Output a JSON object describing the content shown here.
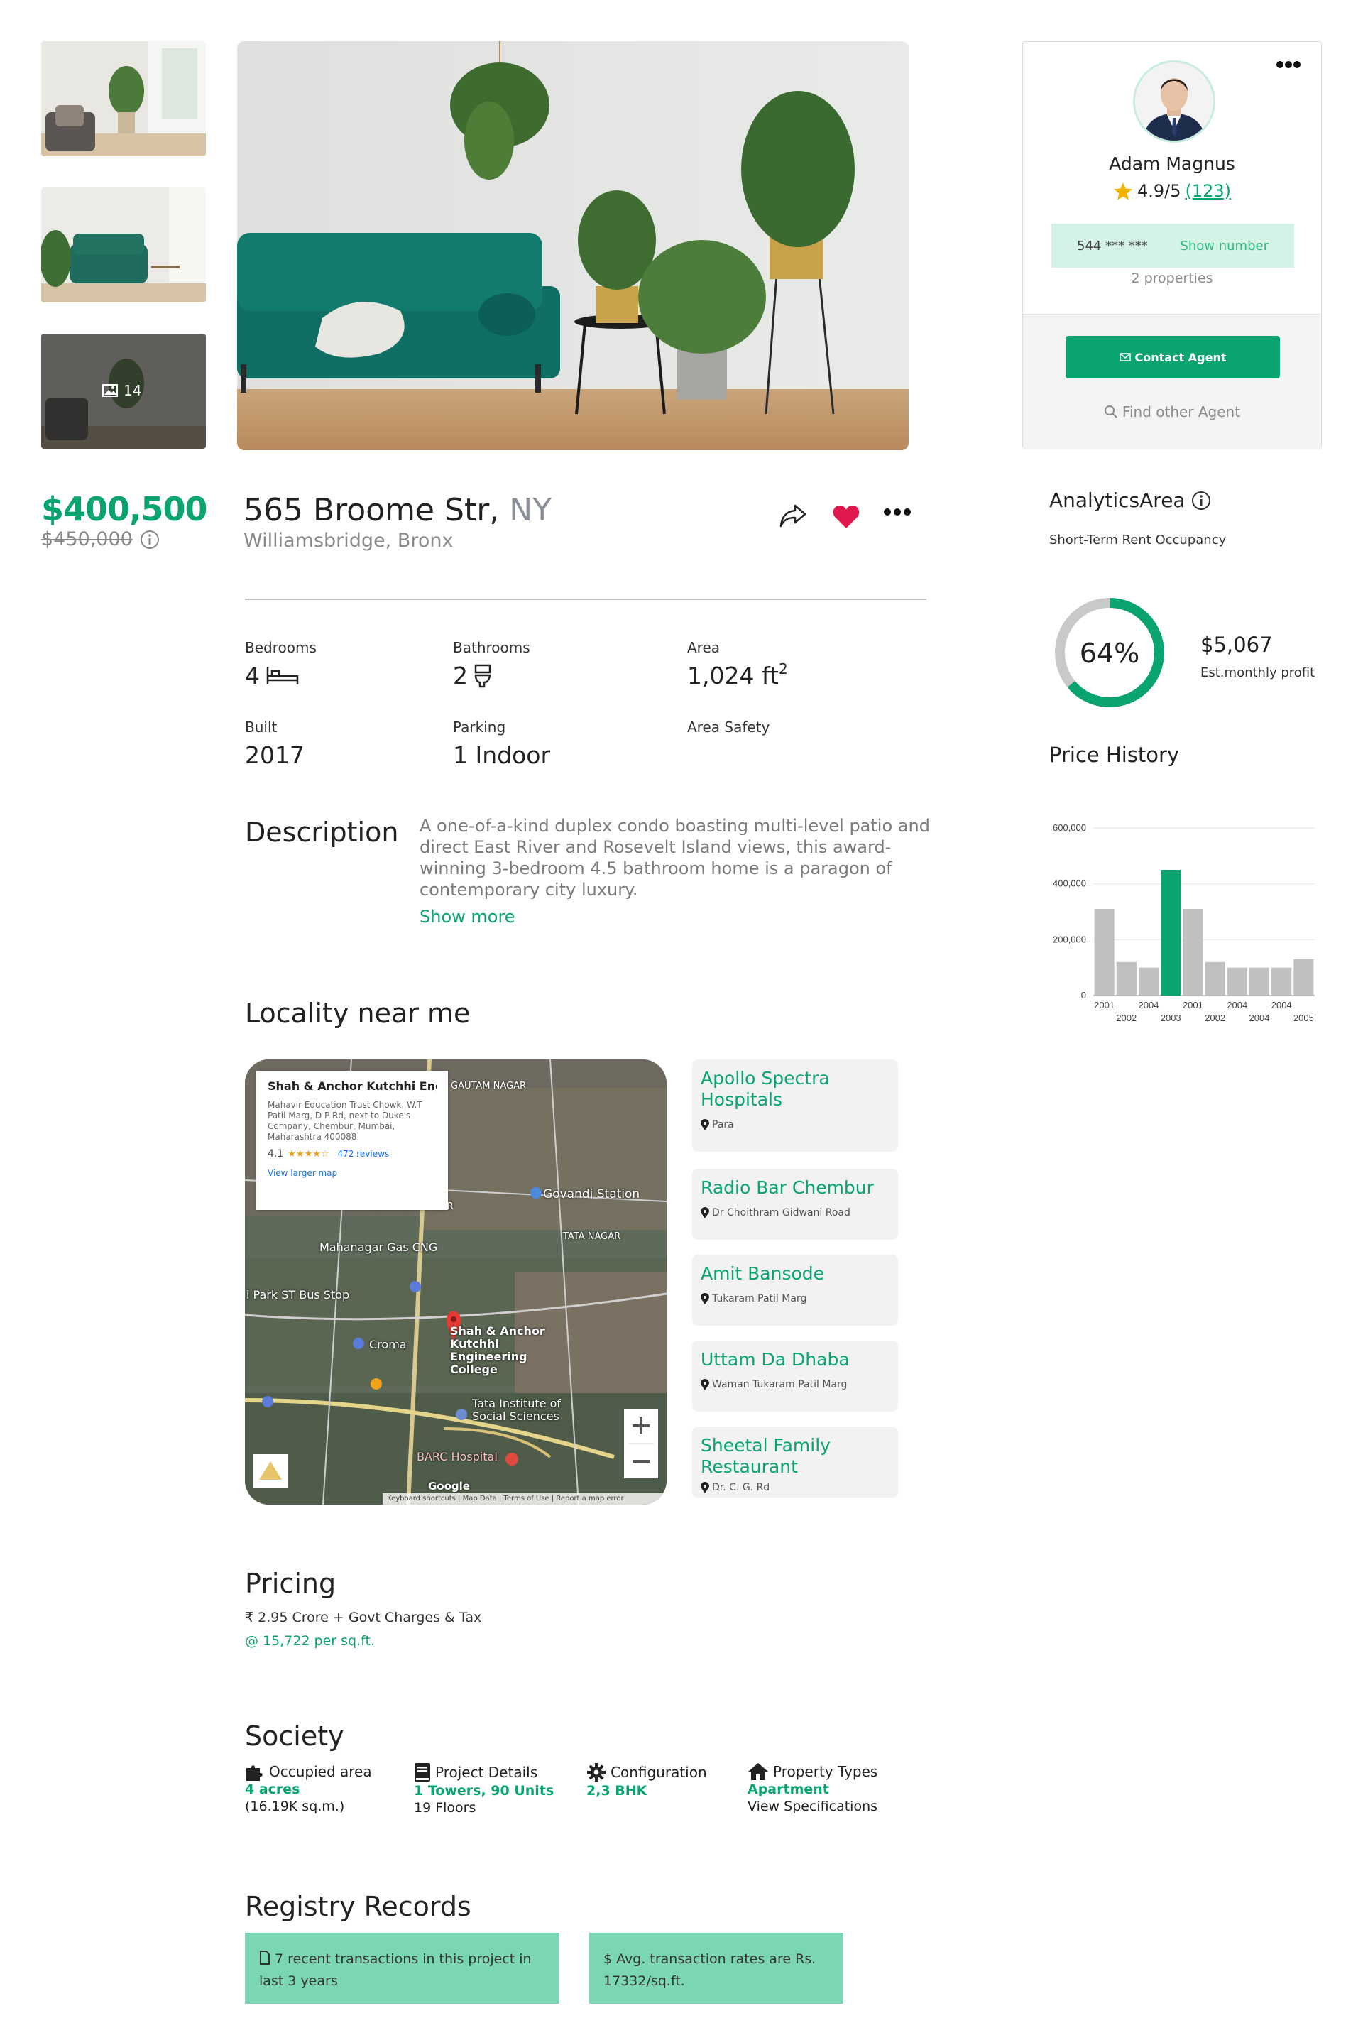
{
  "gallery": {
    "more_count": "14"
  },
  "price": {
    "current": "$400,500",
    "original": "$450,000"
  },
  "property": {
    "address": "565 Broome Str,",
    "city": "NY",
    "neighborhood": "Williamsbridge, Bronx"
  },
  "specs": [
    {
      "label": "Bedrooms",
      "value": "4"
    },
    {
      "label": "Bathrooms",
      "value": "2"
    },
    {
      "label": "Area",
      "value": "1,024 ft",
      "sup": "2"
    },
    {
      "label": "Built",
      "value": "2017"
    },
    {
      "label": "Parking",
      "value": "1 Indoor"
    },
    {
      "label": "Area Safety",
      "value": ""
    }
  ],
  "description": {
    "title": "Description",
    "text": "A one-of-a-kind duplex condo boasting multi-level patio and direct East River and Rosevelt Island views, this award-winning 3-bedroom 4.5 bathroom home is a paragon of contemporary city luxury.",
    "show_more": "Show more"
  },
  "locality": {
    "title": "Locality near me",
    "map_card": {
      "name": "Shah & Anchor Kutchhi Engine...",
      "address": "Mahavir Education Trust Chowk, W.T Patil Marg, D P Rd, next to Duke's Company, Chembur, Mumbai, Maharashtra 400088",
      "rating": "4.1",
      "stars": "★★★★☆",
      "reviews": "472 reviews",
      "larger_map": "View larger map"
    },
    "map_labels": {
      "pin": "Shah & Anchor Kutchhi Engineering College",
      "station": "Govandi Station",
      "gas": "Mahanagar Gas CNG",
      "bus": "i Park ST Bus Stop",
      "croma": "Croma",
      "tiss": "Tata Institute of Social Sciences",
      "barc": "BARC Hospital",
      "gautam": "GAUTAM NAGAR",
      "santosh": "SANTOSH NAGAR",
      "tata": "TATA NAGAR",
      "footer": "Keyboard shortcuts  |  Map Data  |  Terms of Use  |  Report a map error",
      "google": "Google"
    },
    "places": [
      {
        "name": "Apollo Spectra Hospitals",
        "addr": "Para"
      },
      {
        "name": "Radio Bar Chembur",
        "addr": "Dr Choithram Gidwani Road"
      },
      {
        "name": "Amit Bansode",
        "addr": "Tukaram Patil Marg"
      },
      {
        "name": "Uttam Da Dhaba",
        "addr": "Waman Tukaram Patil Marg"
      },
      {
        "name": "Sheetal Family Restaurant",
        "addr": "Dr. C. G. Rd"
      }
    ]
  },
  "pricing": {
    "title": "Pricing",
    "line1": "₹ 2.95 Crore + Govt Charges & Tax",
    "line2": "@ 15,722 per sq.ft."
  },
  "society": {
    "title": "Society",
    "items": [
      {
        "label": "Occupied area",
        "value": "4 acres",
        "sub": "(16.19K sq.m.)"
      },
      {
        "label": "Project Details",
        "value": "1 Towers, 90 Units",
        "sub": "19 Floors"
      },
      {
        "label": "Configuration",
        "value": "2,3 BHK",
        "sub": ""
      },
      {
        "label": "Property Types",
        "value": "Apartment",
        "sub": "View Specifications"
      }
    ]
  },
  "registry": {
    "title": "Registry Records",
    "box1": "7 recent transactions in this project in last 3 years",
    "box2": "$ Avg. transaction rates are Rs. 17332/sq.ft."
  },
  "agent": {
    "name": "Adam Magnus",
    "rating": "4.9/5",
    "reviews": "(123)",
    "phone": "544 *** ***",
    "show_number": "Show number",
    "properties": "2 properties",
    "contact": "Contact Agent",
    "find_other": "Find other Agent"
  },
  "analytics": {
    "title": "AnalyticsArea",
    "subtitle": "Short-Term Rent Occupancy",
    "occupancy_percent": 64,
    "occupancy_label": "64%",
    "profit": "$5,067",
    "profit_label": "Est.monthly profit"
  },
  "colors": {
    "accent": "#0aa56e",
    "heart": "#e0184d",
    "bar": "#c0c0c0"
  },
  "chart_data": {
    "type": "bar",
    "title": "Price History",
    "categories": [
      "2001",
      "2002",
      "2004",
      "2003",
      "2001",
      "2002",
      "2004",
      "2004",
      "2004",
      "2005"
    ],
    "values": [
      310000,
      120000,
      100000,
      450000,
      310000,
      120000,
      100000,
      100000,
      100000,
      130000
    ],
    "highlight_index": 3,
    "ylim": [
      0,
      600000
    ],
    "yticks": [
      "0",
      "200,000",
      "400,000",
      "600,000"
    ],
    "ytick_values": [
      0,
      200000,
      400000,
      600000
    ],
    "grid": true
  }
}
